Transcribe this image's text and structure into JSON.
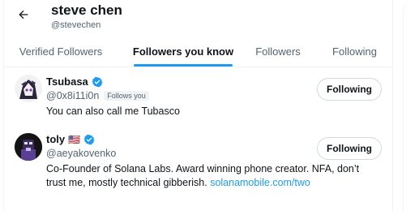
{
  "header": {
    "title": "steve chen",
    "handle": "@stevechen"
  },
  "tabs": [
    {
      "label": "Verified Followers",
      "active": false
    },
    {
      "label": "Followers you know",
      "active": true
    },
    {
      "label": "Followers",
      "active": false
    },
    {
      "label": "Following",
      "active": false
    }
  ],
  "users": [
    {
      "name": "Tsubasa",
      "handle": "@0x8i11i0n",
      "follows_you": "Follows you",
      "bio": "You can also call me Tubasco",
      "button": "Following",
      "verified": true
    },
    {
      "name": "toly",
      "flag": "🇺🇸",
      "handle": "@aeyakovenko",
      "bio_text": "Co-Founder of Solana Labs. Award winning phone creator. NFA, don’t trust me, mostly technical gibberish.",
      "bio_link": "solanamobile.com/two",
      "button": "Following",
      "verified": true
    }
  ],
  "colors": {
    "accent": "#1d9bf0",
    "text": "#0f1419",
    "secondary": "#536471",
    "border": "#eff3f4"
  }
}
